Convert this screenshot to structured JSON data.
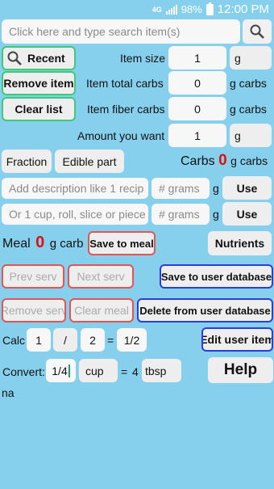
{
  "status": {
    "network": "4G",
    "battery": "98%",
    "time": "12:00 PM"
  },
  "search": {
    "placeholder": "Click here and type search item(s)"
  },
  "icons": {
    "search": "search-icon",
    "recent": "search-icon"
  },
  "buttons": {
    "recent": "Recent",
    "remove_item": "Remove item",
    "clear_list": "Clear list",
    "fraction": "Fraction",
    "edible_part": "Edible part",
    "use1": "Use",
    "use2": "Use",
    "save_to_meal": "Save to meal",
    "nutrients": "Nutrients",
    "prev_serv": "Prev serv",
    "next_serv": "Next serv",
    "save_user_db": "Save to user database",
    "remove_serv": "Remove serv",
    "clear_meal": "Clear meal",
    "delete_user_db": "Delete from user database",
    "edit_user_item": "Edit user item",
    "help": "Help"
  },
  "item": {
    "size_label": "Item size",
    "size_value": "1",
    "size_unit": "g",
    "total_carbs_label": "Item total carbs",
    "total_carbs_value": "0",
    "total_carbs_unit": "g carbs",
    "fiber_label": "Item fiber carbs",
    "fiber_value": "0",
    "fiber_unit": "g carbs",
    "amount_label": "Amount you want",
    "amount_value": "1",
    "amount_unit": "g"
  },
  "carbs": {
    "label": "Carbs",
    "value": "0",
    "unit": "g carbs"
  },
  "description": {
    "placeholder1": "Add description like 1 recip",
    "grams_placeholder1": "# grams",
    "unit1": "g",
    "placeholder2": "Or 1 cup, roll, slice or piece",
    "grams_placeholder2": "# grams",
    "unit2": "g"
  },
  "meal": {
    "label": "Meal",
    "value": "0",
    "unit": "g carb"
  },
  "calc": {
    "label": "Calc",
    "num": "1",
    "op": "/",
    "den": "2",
    "eq": "=",
    "result": "1/2"
  },
  "convert": {
    "label": "Convert:",
    "from_value": "1/4",
    "from_unit": "cup",
    "eq": "=",
    "to_value": "4",
    "to_unit": "tbsp"
  },
  "footer_text": "na",
  "colors": {
    "background": "#86d0ee",
    "green_border": "#3ec97a",
    "red_border": "#e05656",
    "blue_border": "#2b3fd8",
    "red_number": "#e01010"
  }
}
